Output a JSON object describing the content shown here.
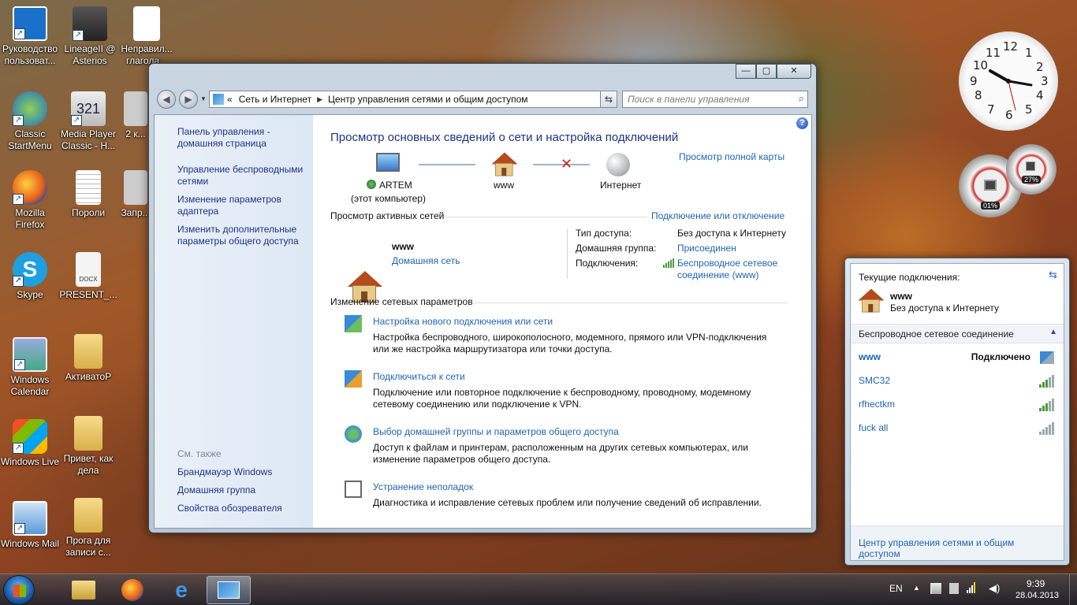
{
  "desktop": {
    "icons": [
      {
        "label": "Руководство пользоват..."
      },
      {
        "label": "LineageII @ Asterios"
      },
      {
        "label": "Неправил... глагола..."
      },
      {
        "label": "Classic StartMenu"
      },
      {
        "label": "Media Player Classic - H..."
      },
      {
        "label": "2 к..."
      },
      {
        "label": "Mozilla Firefox"
      },
      {
        "label": "Пороли"
      },
      {
        "label": "Запр..."
      },
      {
        "label": "Skype"
      },
      {
        "label": "PRESENT_..."
      },
      {
        "label": "Windows Calendar"
      },
      {
        "label": "АктиватоР"
      },
      {
        "label": "Windows Live"
      },
      {
        "label": "Привет, как дела"
      },
      {
        "label": "Windows Mail"
      },
      {
        "label": "Прога для записи с..."
      }
    ],
    "icon_names": [
      "lenovo-guide-icon",
      "lineage-icon",
      "document-icon",
      "classic-startmenu-icon",
      "media-player-icon",
      "file-icon",
      "firefox-icon",
      "text-file-icon",
      "file-icon",
      "skype-icon",
      "docx-icon",
      "calendar-icon",
      "folder-icon",
      "windows-live-icon",
      "docx-folder-icon",
      "windows-mail-icon",
      "folder-icon"
    ]
  },
  "gadgets": {
    "clock_numbers": [
      "12",
      "1",
      "2",
      "3",
      "4",
      "5",
      "6",
      "7",
      "8",
      "9",
      "10",
      "11"
    ],
    "cpu_meter": {
      "cpu": "01%",
      "memory": "27%",
      "cpu_value": 0.01,
      "memory_value": 0.27
    }
  },
  "window": {
    "controls": {
      "minimize": "—",
      "maximize": "▢",
      "close": "✕"
    },
    "breadcrumb": {
      "prefix": "«",
      "items": [
        "Сеть и Интернет",
        "Центр управления сетями и общим доступом"
      ]
    },
    "search_placeholder": "Поиск в панели управления",
    "sidebar": {
      "home": "Панель управления - домашняя страница",
      "links": [
        "Управление беспроводными сетями",
        "Изменение параметров адаптера",
        "Изменить дополнительные параметры общего доступа"
      ],
      "see_also_label": "См. также",
      "see_also": [
        "Брандмауэр Windows",
        "Домашняя группа",
        "Свойства обозревателя"
      ]
    },
    "main": {
      "title": "Просмотр основных сведений о сети и настройка подключений",
      "full_map_link": "Просмотр полной карты",
      "map": {
        "computer_name": "ARTEM",
        "computer_sub": "(этот компьютер)",
        "network_name": "www",
        "internet_label": "Интернет"
      },
      "active_networks": {
        "heading": "Просмотр активных сетей",
        "connect_link": "Подключение или отключение",
        "network_name": "www",
        "network_type": "Домашняя сеть",
        "access_type_label": "Тип доступа:",
        "access_type_value": "Без доступа к Интернету",
        "homegroup_label": "Домашняя группа:",
        "homegroup_value": "Присоединен",
        "connections_label": "Подключения:",
        "connections_value": "Беспроводное сетевое соединение (www)"
      },
      "change_settings": {
        "heading": "Изменение сетевых параметров",
        "tasks": [
          {
            "title": "Настройка нового подключения или сети",
            "desc": "Настройка беспроводного, широкополосного, модемного, прямого или VPN-подключения или же настройка маршрутизатора или точки доступа."
          },
          {
            "title": "Подключиться к сети",
            "desc": "Подключение или повторное подключение к беспроводному, проводному, модемному сетевому соединению или подключение к VPN."
          },
          {
            "title": "Выбор домашней группы и параметров общего доступа",
            "desc": "Доступ к файлам и принтерам, расположенным на других сетевых компьютерах, или изменение параметров общего доступа."
          },
          {
            "title": "Устранение неполадок",
            "desc": "Диагностика и исправление сетевых проблем или получение сведений об исправлении."
          }
        ]
      }
    }
  },
  "flyout": {
    "current_label": "Текущие подключения:",
    "current_network": "www",
    "current_status": "Без доступа к Интернету",
    "section_label": "Беспроводное сетевое соединение",
    "networks": [
      {
        "name": "www",
        "status": "Подключено"
      },
      {
        "name": "SMC32",
        "status": ""
      },
      {
        "name": "rfhectkm",
        "status": ""
      },
      {
        "name": "fuck all",
        "status": ""
      }
    ],
    "footer_link": "Центр управления сетями и общим доступом"
  },
  "taskbar": {
    "language": "EN",
    "time": "9:39",
    "date": "28.04.2013",
    "pinned": [
      "explorer-icon",
      "firefox-icon",
      "internet-explorer-icon",
      "control-panel-icon"
    ]
  },
  "colors": {
    "link": "#1e64b4",
    "title": "#1e3287",
    "signal_green": "#4a9a3a",
    "disconnect_red": "#d42020"
  }
}
